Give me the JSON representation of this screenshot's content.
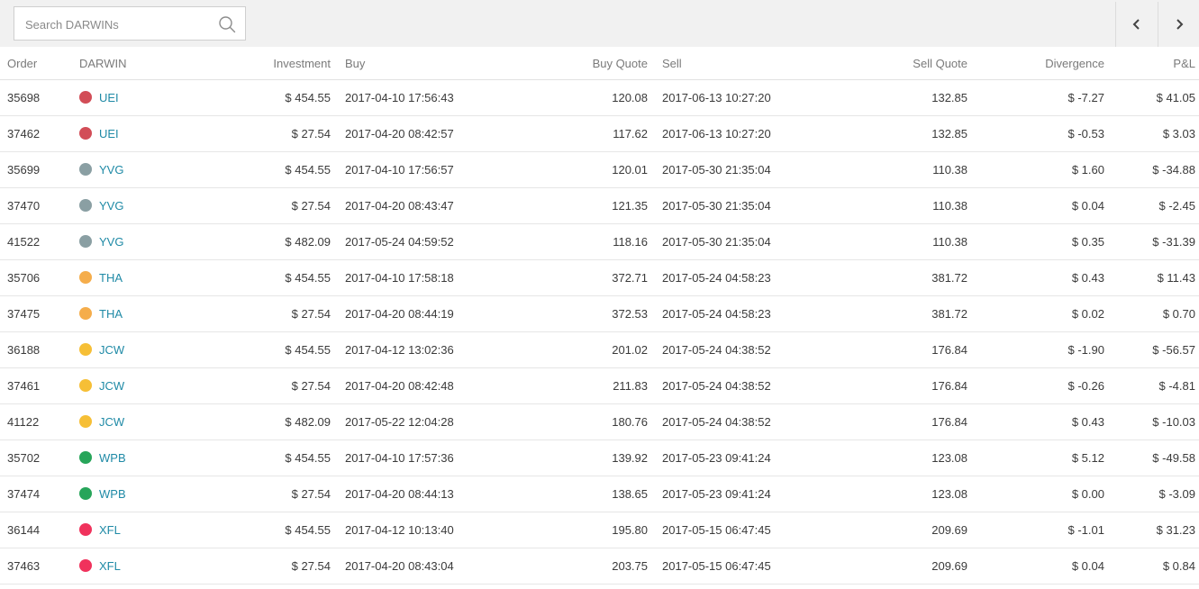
{
  "search": {
    "placeholder": "Search DARWINs",
    "icon": "search-icon"
  },
  "pager": {
    "prev_icon": "chevron-left-icon",
    "next_icon": "chevron-right-icon"
  },
  "colors": {
    "link": "#1f8aa6",
    "positive": "#7eb03e",
    "negative": "#c0403a",
    "UEI": "#d24d57",
    "YVG": "#8a9fa3",
    "THA": "#f5ad4b",
    "JCW": "#f6bf36",
    "WPB": "#27a55a",
    "XFL": "#f0325c"
  },
  "table": {
    "headers": {
      "order": "Order",
      "darwin": "DARWIN",
      "investment": "Investment",
      "buy": "Buy",
      "buy_quote": "Buy Quote",
      "sell": "Sell",
      "sell_quote": "Sell Quote",
      "divergence": "Divergence",
      "pnl": "P&L"
    },
    "rows": [
      {
        "order": "35698",
        "darwin": "UEI",
        "investment": "$ 454.55",
        "buy": "2017-04-10 17:56:43",
        "buy_quote": "120.08",
        "sell": "2017-06-13 10:27:20",
        "sell_quote": "132.85",
        "divergence": "$ -7.27",
        "pnl": "$ 41.05"
      },
      {
        "order": "37462",
        "darwin": "UEI",
        "investment": "$ 27.54",
        "buy": "2017-04-20 08:42:57",
        "buy_quote": "117.62",
        "sell": "2017-06-13 10:27:20",
        "sell_quote": "132.85",
        "divergence": "$ -0.53",
        "pnl": "$ 3.03"
      },
      {
        "order": "35699",
        "darwin": "YVG",
        "investment": "$ 454.55",
        "buy": "2017-04-10 17:56:57",
        "buy_quote": "120.01",
        "sell": "2017-05-30 21:35:04",
        "sell_quote": "110.38",
        "divergence": "$ 1.60",
        "pnl": "$ -34.88"
      },
      {
        "order": "37470",
        "darwin": "YVG",
        "investment": "$ 27.54",
        "buy": "2017-04-20 08:43:47",
        "buy_quote": "121.35",
        "sell": "2017-05-30 21:35:04",
        "sell_quote": "110.38",
        "divergence": "$ 0.04",
        "pnl": "$ -2.45"
      },
      {
        "order": "41522",
        "darwin": "YVG",
        "investment": "$ 482.09",
        "buy": "2017-05-24 04:59:52",
        "buy_quote": "118.16",
        "sell": "2017-05-30 21:35:04",
        "sell_quote": "110.38",
        "divergence": "$ 0.35",
        "pnl": "$ -31.39"
      },
      {
        "order": "35706",
        "darwin": "THA",
        "investment": "$ 454.55",
        "buy": "2017-04-10 17:58:18",
        "buy_quote": "372.71",
        "sell": "2017-05-24 04:58:23",
        "sell_quote": "381.72",
        "divergence": "$ 0.43",
        "pnl": "$ 11.43"
      },
      {
        "order": "37475",
        "darwin": "THA",
        "investment": "$ 27.54",
        "buy": "2017-04-20 08:44:19",
        "buy_quote": "372.53",
        "sell": "2017-05-24 04:58:23",
        "sell_quote": "381.72",
        "divergence": "$ 0.02",
        "pnl": "$ 0.70"
      },
      {
        "order": "36188",
        "darwin": "JCW",
        "investment": "$ 454.55",
        "buy": "2017-04-12 13:02:36",
        "buy_quote": "201.02",
        "sell": "2017-05-24 04:38:52",
        "sell_quote": "176.84",
        "divergence": "$ -1.90",
        "pnl": "$ -56.57"
      },
      {
        "order": "37461",
        "darwin": "JCW",
        "investment": "$ 27.54",
        "buy": "2017-04-20 08:42:48",
        "buy_quote": "211.83",
        "sell": "2017-05-24 04:38:52",
        "sell_quote": "176.84",
        "divergence": "$ -0.26",
        "pnl": "$ -4.81"
      },
      {
        "order": "41122",
        "darwin": "JCW",
        "investment": "$ 482.09",
        "buy": "2017-05-22 12:04:28",
        "buy_quote": "180.76",
        "sell": "2017-05-24 04:38:52",
        "sell_quote": "176.84",
        "divergence": "$ 0.43",
        "pnl": "$ -10.03"
      },
      {
        "order": "35702",
        "darwin": "WPB",
        "investment": "$ 454.55",
        "buy": "2017-04-10 17:57:36",
        "buy_quote": "139.92",
        "sell": "2017-05-23 09:41:24",
        "sell_quote": "123.08",
        "divergence": "$ 5.12",
        "pnl": "$ -49.58"
      },
      {
        "order": "37474",
        "darwin": "WPB",
        "investment": "$ 27.54",
        "buy": "2017-04-20 08:44:13",
        "buy_quote": "138.65",
        "sell": "2017-05-23 09:41:24",
        "sell_quote": "123.08",
        "divergence": "$ 0.00",
        "pnl": "$ -3.09"
      },
      {
        "order": "36144",
        "darwin": "XFL",
        "investment": "$ 454.55",
        "buy": "2017-04-12 10:13:40",
        "buy_quote": "195.80",
        "sell": "2017-05-15 06:47:45",
        "sell_quote": "209.69",
        "divergence": "$ -1.01",
        "pnl": "$ 31.23"
      },
      {
        "order": "37463",
        "darwin": "XFL",
        "investment": "$ 27.54",
        "buy": "2017-04-20 08:43:04",
        "buy_quote": "203.75",
        "sell": "2017-05-15 06:47:45",
        "sell_quote": "209.69",
        "divergence": "$ 0.04",
        "pnl": "$ 0.84"
      }
    ]
  }
}
